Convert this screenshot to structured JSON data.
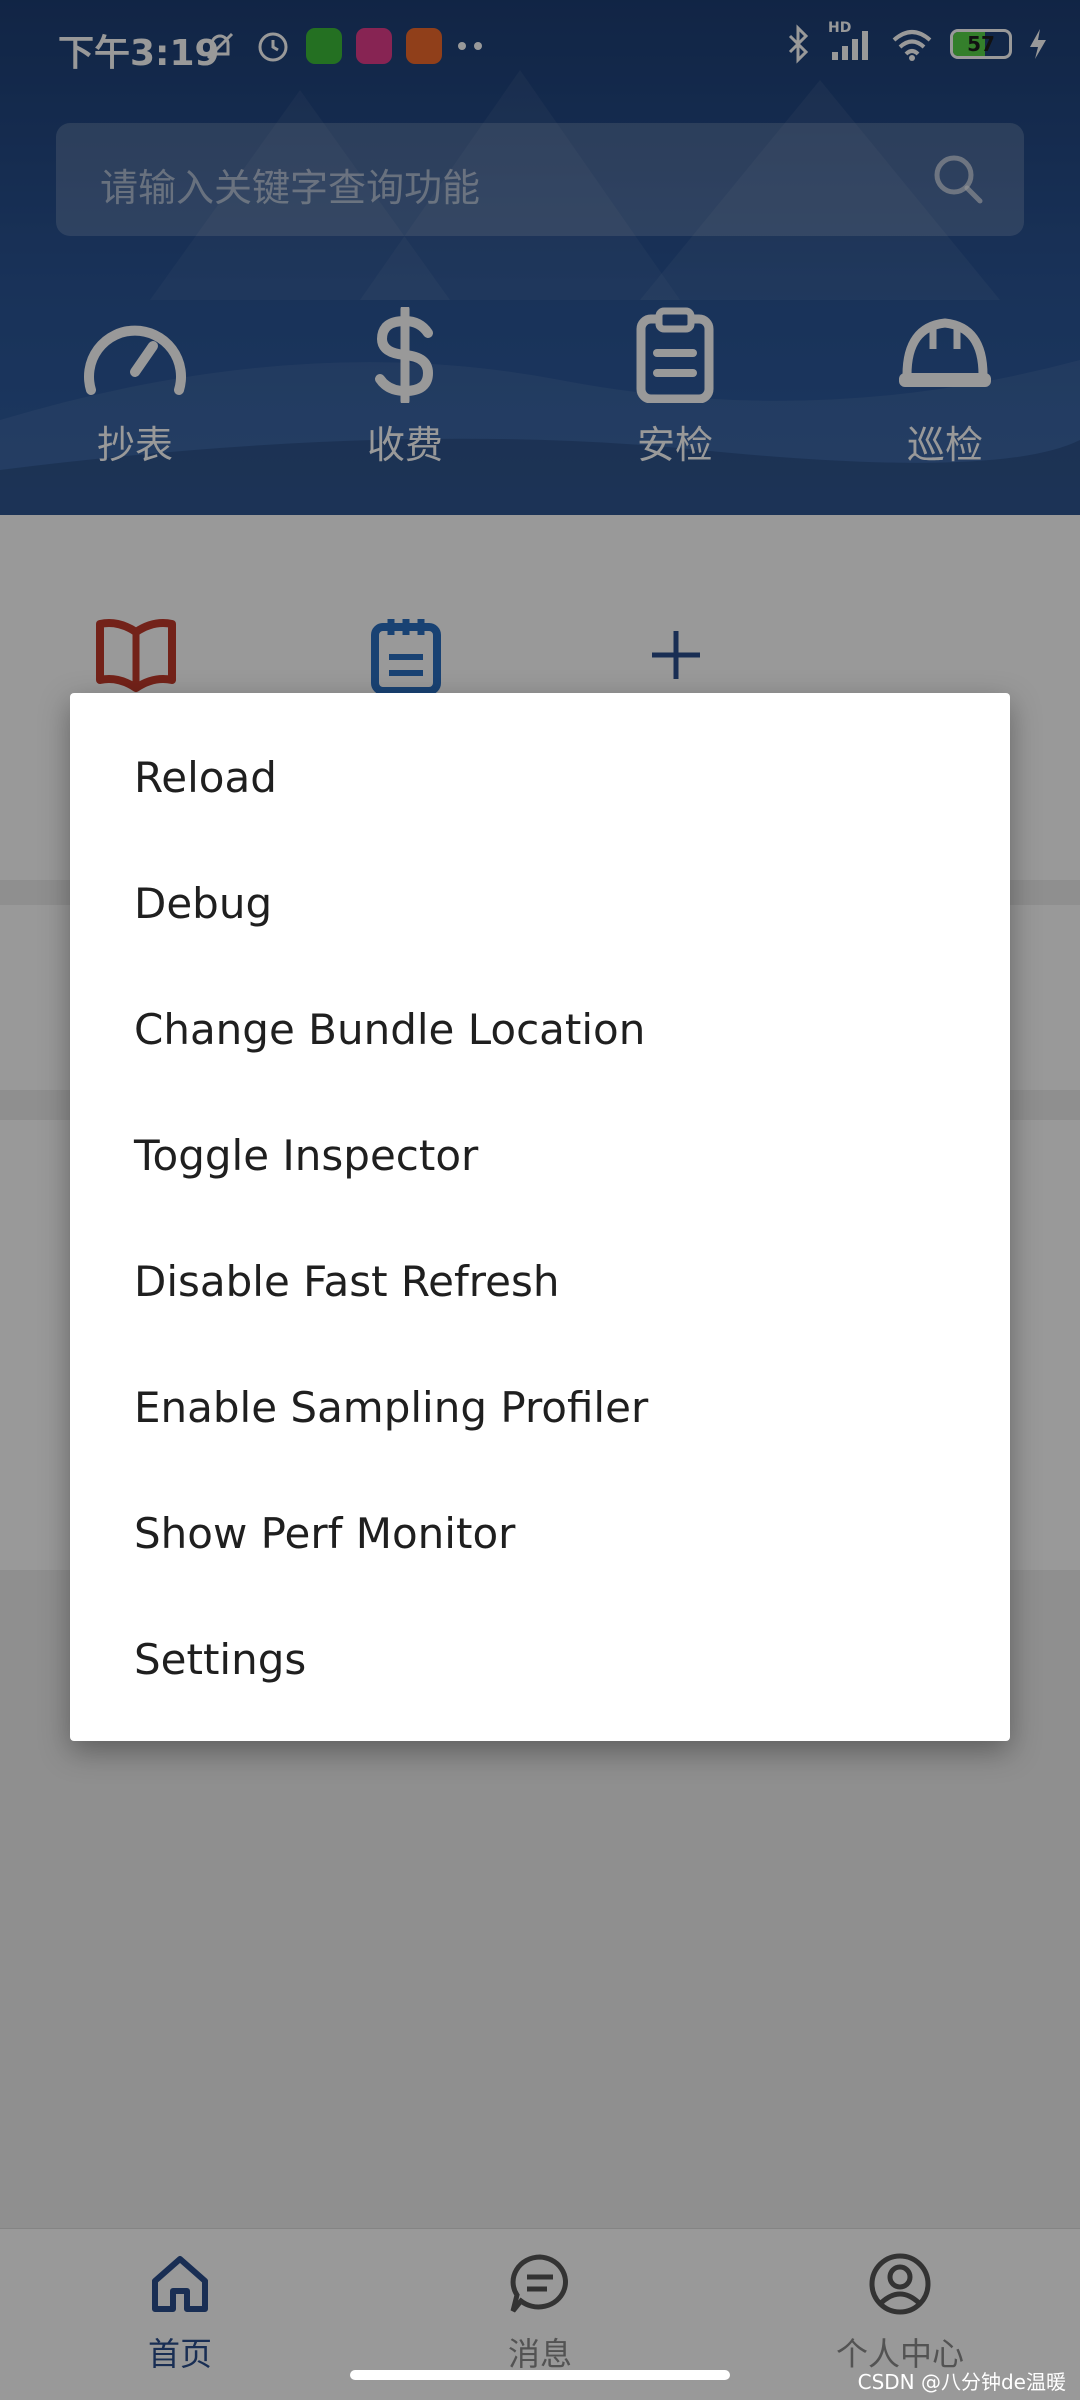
{
  "status_bar": {
    "time": "下午3:19",
    "battery": "57",
    "network": "HD"
  },
  "search": {
    "placeholder": "请输入关键字查询功能"
  },
  "quick_actions": [
    {
      "label": "抄表",
      "icon": "gauge-icon"
    },
    {
      "label": "收费",
      "icon": "dollar-icon"
    },
    {
      "label": "安检",
      "icon": "clipboard-icon"
    },
    {
      "label": "巡检",
      "icon": "hardhat-icon"
    }
  ],
  "services": [
    {
      "icon": "book-icon",
      "color": "#c0392b"
    },
    {
      "icon": "notepad-icon",
      "color": "#2a6fc0"
    },
    {
      "icon": "plus-icon",
      "color": "#2b4e8c"
    }
  ],
  "dev_menu": {
    "items": [
      "Reload",
      "Debug",
      "Change Bundle Location",
      "Toggle Inspector",
      "Disable Fast Refresh",
      "Enable Sampling Profiler",
      "Show Perf Monitor",
      "Settings"
    ]
  },
  "bottom_nav": {
    "items": [
      {
        "label": "首页",
        "icon": "home-icon",
        "active": true
      },
      {
        "label": "消息",
        "icon": "message-icon",
        "active": false
      },
      {
        "label": "个人中心",
        "icon": "user-icon",
        "active": false
      }
    ]
  },
  "watermark": "CSDN @八分钟de温暖",
  "colors": {
    "header": "#2a5494",
    "accent": "#2b4e8c",
    "battery": "#57d449"
  }
}
